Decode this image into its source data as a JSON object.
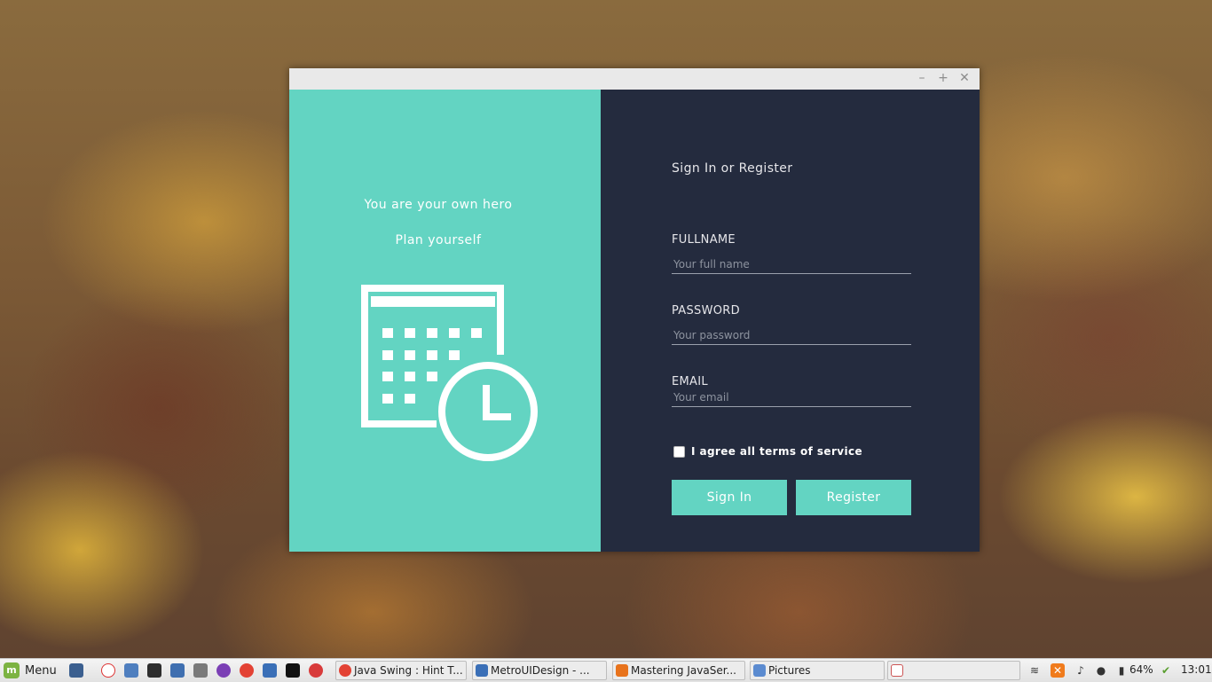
{
  "window": {
    "controls": {
      "minimize": "–",
      "maximize": "+",
      "close": "✕"
    }
  },
  "left_panel": {
    "tagline_1": "You are your own hero",
    "tagline_2": "Plan yourself",
    "icon": "calendar-clock-icon"
  },
  "form": {
    "title": "Sign In or Register",
    "fields": [
      {
        "label": "FULLNAME",
        "placeholder": "Your full name"
      },
      {
        "label": "PASSWORD",
        "placeholder": "Your password"
      },
      {
        "label": "EMAIL",
        "placeholder": "Your email"
      }
    ],
    "agree_label": "I agree all terms of service",
    "agree_checked": false,
    "signin_label": "Sign In",
    "register_label": "Register"
  },
  "colors": {
    "accent": "#63d4c2",
    "panel_dark": "#242b3e"
  },
  "taskbar": {
    "menu_label": "Menu",
    "tasks": [
      {
        "label": "Java Swing : Hint T...",
        "icon": "chrome-icon"
      },
      {
        "label": "MetroUIDesign - ...",
        "icon": "netbeans-icon"
      },
      {
        "label": "Mastering JavaSer...",
        "icon": "gitbook-icon"
      },
      {
        "label": "Pictures",
        "icon": "folder-icon"
      },
      {
        "label": "",
        "icon": "java-icon"
      }
    ],
    "battery": "64%",
    "clock": "13:01"
  }
}
